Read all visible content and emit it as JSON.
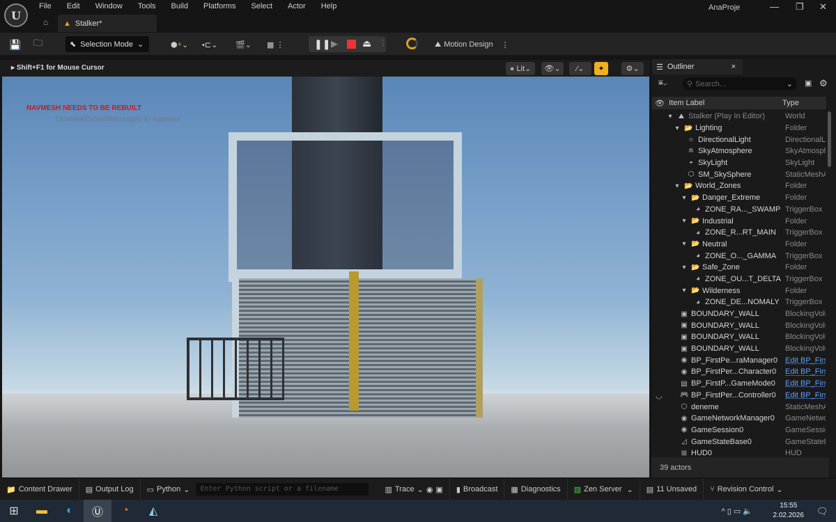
{
  "menu": {
    "items": [
      "File",
      "Edit",
      "Window",
      "Tools",
      "Build",
      "Platforms",
      "Select",
      "Actor",
      "Help"
    ],
    "project": "AnaProje",
    "logo": "UE"
  },
  "tab": {
    "label": "Stalker*"
  },
  "toolbar": {
    "selection_mode": "Selection Mode",
    "motion_design": "Motion Design"
  },
  "viewport": {
    "hint": "Shift+F1 for Mouse Cursor",
    "lit": "Lit",
    "warning": "NAVMESH NEEDS TO BE REBUILT",
    "suppress": "'DisableAllScreenMessages' to suppress"
  },
  "outliner": {
    "title": "Outliner",
    "search_placeholder": "Search...",
    "col_label": "Item Label",
    "col_type": "Type",
    "footer": "39 actors",
    "rows": [
      {
        "label": "Stalker (Play In Editor)",
        "type": "World",
        "indent": 1,
        "icon": "world"
      },
      {
        "label": "Lighting",
        "type": "Folder",
        "indent": 2,
        "icon": "folder"
      },
      {
        "label": "DirectionalLight",
        "type": "DirectionalLi",
        "indent": 3,
        "icon": "light"
      },
      {
        "label": "SkyAtmosphere",
        "type": "SkyAtmosph",
        "indent": 3,
        "icon": "sky"
      },
      {
        "label": "SkyLight",
        "type": "SkyLight",
        "indent": 3,
        "icon": "skylight"
      },
      {
        "label": "SM_SkySphere",
        "type": "StaticMeshA",
        "indent": 3,
        "icon": "mesh"
      },
      {
        "label": "World_Zones",
        "type": "Folder",
        "indent": 2,
        "icon": "folder"
      },
      {
        "label": "Danger_Extreme",
        "type": "Folder",
        "indent": 3,
        "icon": "folder"
      },
      {
        "label": "ZONE_RA..._SWAMP",
        "type": "TriggerBox",
        "indent": 4,
        "icon": "trigger"
      },
      {
        "label": "Industrial",
        "type": "Folder",
        "indent": 3,
        "icon": "folder"
      },
      {
        "label": "ZONE_R...RT_MAIN",
        "type": "TriggerBox",
        "indent": 4,
        "icon": "trigger"
      },
      {
        "label": "Neutral",
        "type": "Folder",
        "indent": 3,
        "icon": "folder"
      },
      {
        "label": "ZONE_O..._GAMMA",
        "type": "TriggerBox",
        "indent": 4,
        "icon": "trigger"
      },
      {
        "label": "Safe_Zone",
        "type": "Folder",
        "indent": 3,
        "icon": "folder"
      },
      {
        "label": "ZONE_OU...T_DELTA",
        "type": "TriggerBox",
        "indent": 4,
        "icon": "trigger"
      },
      {
        "label": "Wilderness",
        "type": "Folder",
        "indent": 3,
        "icon": "folder"
      },
      {
        "label": "ZONE_DE...NOMALY",
        "type": "TriggerBox",
        "indent": 4,
        "icon": "trigger"
      },
      {
        "label": "BOUNDARY_WALL",
        "type": "BlockingVolu",
        "indent": 2,
        "icon": "block"
      },
      {
        "label": "BOUNDARY_WALL",
        "type": "BlockingVolu",
        "indent": 2,
        "icon": "block"
      },
      {
        "label": "BOUNDARY_WALL",
        "type": "BlockingVolu",
        "indent": 2,
        "icon": "block"
      },
      {
        "label": "BOUNDARY_WALL",
        "type": "BlockingVolu",
        "indent": 2,
        "icon": "block"
      },
      {
        "label": "BP_FirstPe...raManager0",
        "type": "Edit BP_Firs",
        "indent": 2,
        "icon": "actor",
        "link": true
      },
      {
        "label": "BP_FirstPer...Character0",
        "type": "Edit BP_Firs",
        "indent": 2,
        "icon": "actor",
        "link": true
      },
      {
        "label": "BP_FirstP...GameMode0",
        "type": "Edit BP_Firs",
        "indent": 2,
        "icon": "gamemode",
        "link": true
      },
      {
        "label": "BP_FirstPer...Controller0",
        "type": "Edit BP_Firs",
        "indent": 2,
        "icon": "controller",
        "link": true
      },
      {
        "label": "deneme",
        "type": "StaticMeshA",
        "indent": 2,
        "icon": "mesh"
      },
      {
        "label": "GameNetworkManager0",
        "type": "GameNetwo",
        "indent": 2,
        "icon": "actor"
      },
      {
        "label": "GameSession0",
        "type": "GameSessic",
        "indent": 2,
        "icon": "actor"
      },
      {
        "label": "GameStateBase0",
        "type": "GameStateB",
        "indent": 2,
        "icon": "chart"
      },
      {
        "label": "HUD0",
        "type": "HUD",
        "indent": 2,
        "icon": "hud"
      }
    ]
  },
  "status": {
    "content_drawer": "Content Drawer",
    "output_log": "Output Log",
    "python": "Python",
    "python_placeholder": "Enter Python script or a filename",
    "trace": "Trace",
    "broadcast": "Broadcast",
    "diagnostics": "Diagnostics",
    "zen": "Zen Server",
    "unsaved": "11 Unsaved",
    "revision": "Revision Control"
  },
  "taskbar": {
    "time": "15:55",
    "date": "2.02.2026"
  }
}
